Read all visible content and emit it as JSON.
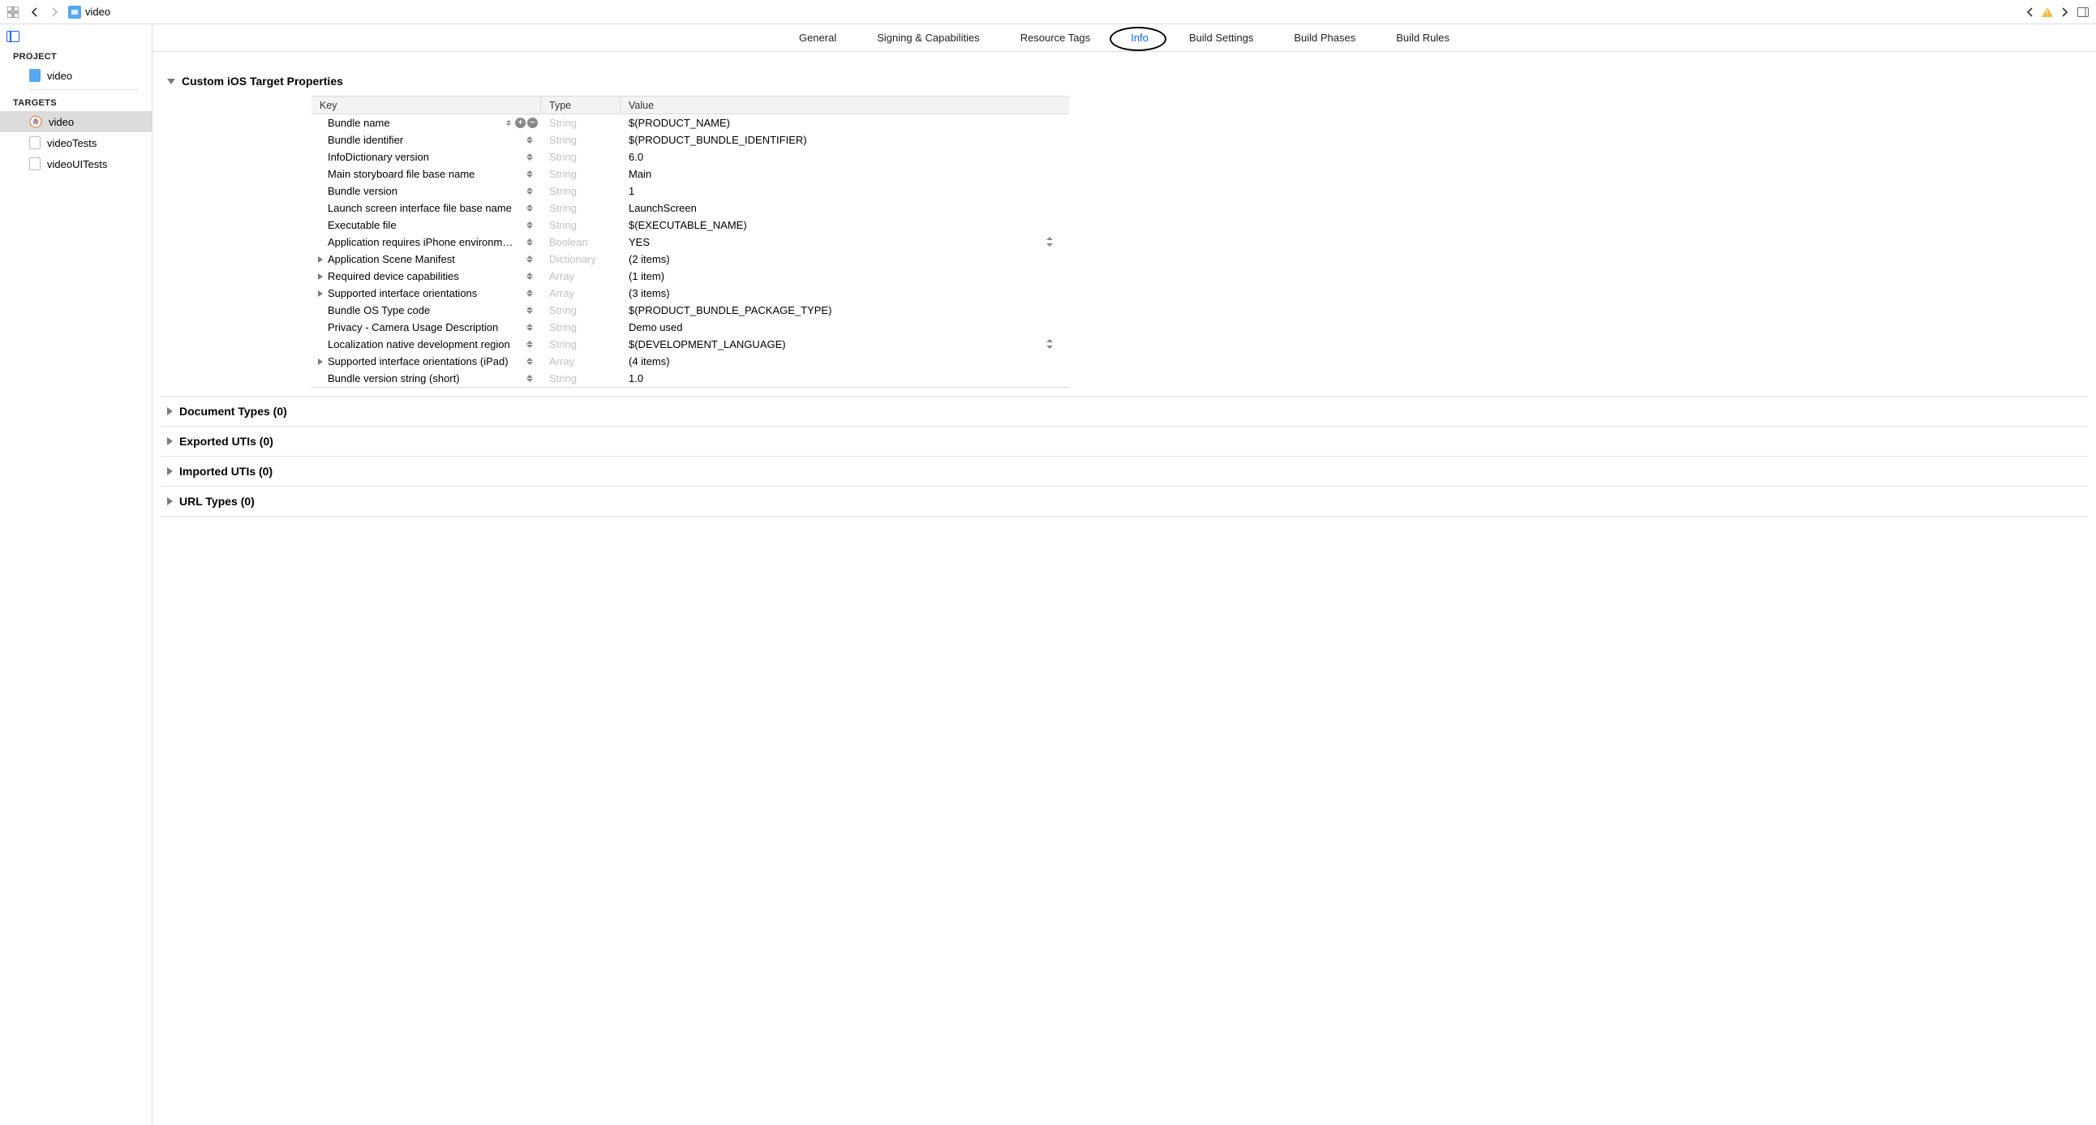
{
  "breadcrumb": {
    "filename": "video"
  },
  "sidebar": {
    "project_label": "PROJECT",
    "targets_label": "TARGETS",
    "project_item": "video",
    "targets": [
      {
        "name": "video"
      },
      {
        "name": "videoTests"
      },
      {
        "name": "videoUITests"
      }
    ]
  },
  "tabs": {
    "general": "General",
    "signing": "Signing & Capabilities",
    "resource": "Resource Tags",
    "info": "Info",
    "buildsettings": "Build Settings",
    "buildphases": "Build Phases",
    "buildrules": "Build Rules"
  },
  "sections": {
    "custom": "Custom iOS Target Properties",
    "doctypes": "Document Types (0)",
    "exported": "Exported UTIs (0)",
    "imported": "Imported UTIs (0)",
    "urltypes": "URL Types (0)"
  },
  "plist": {
    "head_key": "Key",
    "head_type": "Type",
    "head_value": "Value",
    "rows": [
      {
        "key": "Bundle name",
        "type": "String",
        "value": "$(PRODUCT_NAME)",
        "ctrl": true
      },
      {
        "key": "Bundle identifier",
        "type": "String",
        "value": "$(PRODUCT_BUNDLE_IDENTIFIER)"
      },
      {
        "key": "InfoDictionary version",
        "type": "String",
        "value": "6.0"
      },
      {
        "key": "Main storyboard file base name",
        "type": "String",
        "value": "Main"
      },
      {
        "key": "Bundle version",
        "type": "String",
        "value": "1"
      },
      {
        "key": "Launch screen interface file base name",
        "type": "String",
        "value": "LaunchScreen"
      },
      {
        "key": "Executable file",
        "type": "String",
        "value": "$(EXECUTABLE_NAME)"
      },
      {
        "key": "Application requires iPhone environm…",
        "type": "Boolean",
        "value": "YES",
        "far": true
      },
      {
        "key": "Application Scene Manifest",
        "type": "Dictionary",
        "value": "(2 items)",
        "expandable": true
      },
      {
        "key": "Required device capabilities",
        "type": "Array",
        "value": "(1 item)",
        "expandable": true
      },
      {
        "key": "Supported interface orientations",
        "type": "Array",
        "value": "(3 items)",
        "expandable": true
      },
      {
        "key": "Bundle OS Type code",
        "type": "String",
        "value": "$(PRODUCT_BUNDLE_PACKAGE_TYPE)"
      },
      {
        "key": "Privacy - Camera Usage Description",
        "type": "String",
        "value": "Demo used"
      },
      {
        "key": "Localization native development region",
        "type": "String",
        "value": "$(DEVELOPMENT_LANGUAGE)",
        "far": true
      },
      {
        "key": "Supported interface orientations (iPad)",
        "type": "Array",
        "value": "(4 items)",
        "expandable": true
      },
      {
        "key": "Bundle version string (short)",
        "type": "String",
        "value": "1.0"
      }
    ]
  }
}
